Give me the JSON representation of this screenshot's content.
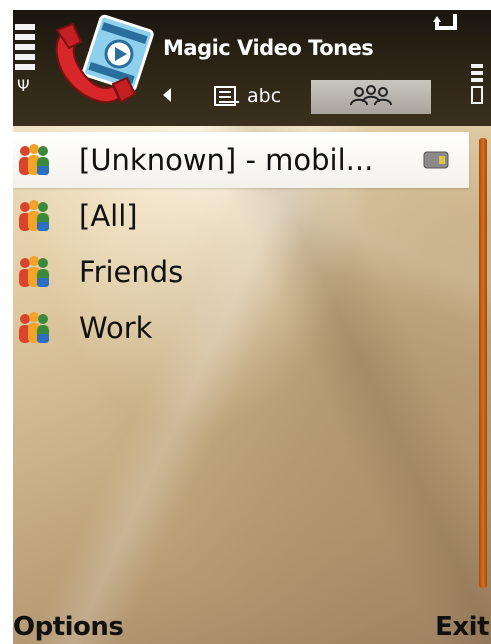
{
  "app": {
    "title": "Magic Video Tones"
  },
  "tabs": [
    {
      "label": "abc",
      "icon": "contacts-list-icon",
      "selected": false
    },
    {
      "label": "",
      "icon": "groups-icon",
      "selected": true
    }
  ],
  "list": {
    "items": [
      {
        "label": "[Unknown] - mobil...",
        "icon": "contact-group-icon",
        "selected": true,
        "badge_icon": "memory-card-icon"
      },
      {
        "label": "[All]",
        "icon": "contact-group-icon",
        "selected": false
      },
      {
        "label": "Friends",
        "icon": "contact-group-icon",
        "selected": false
      },
      {
        "label": "Work",
        "icon": "contact-group-icon",
        "selected": false
      }
    ]
  },
  "softkeys": {
    "left": "Options",
    "right": "Exit"
  },
  "colors": {
    "header_bg": "#2e2616",
    "scroll_thumb": "#d4711f",
    "selected_row": "#ffffff"
  }
}
